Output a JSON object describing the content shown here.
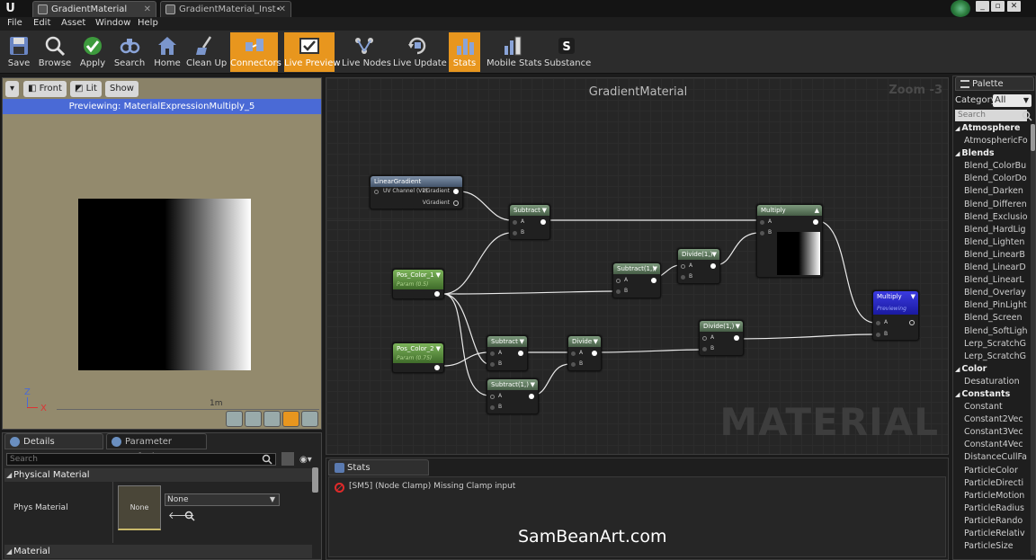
{
  "tabs": [
    {
      "label": "GradientMaterial",
      "active": true
    },
    {
      "label": "GradientMaterial_Inst•",
      "active": false
    }
  ],
  "menu": [
    "File",
    "Edit",
    "Asset",
    "Window",
    "Help"
  ],
  "toolbar": [
    {
      "label": "Save",
      "icon": "save-icon",
      "active": false
    },
    {
      "label": "Browse",
      "icon": "browse-icon",
      "active": false
    },
    {
      "label": "Apply",
      "icon": "apply-icon",
      "active": false
    },
    {
      "label": "Search",
      "icon": "search-icon",
      "active": false
    },
    {
      "label": "Home",
      "icon": "home-icon",
      "active": false
    },
    {
      "label": "Clean Up",
      "icon": "cleanup-icon",
      "active": false
    },
    {
      "label": "Connectors",
      "icon": "connectors-icon",
      "active": true
    },
    {
      "label": "Live Preview",
      "icon": "live-preview-icon",
      "active": true
    },
    {
      "label": "Live Nodes",
      "icon": "live-nodes-icon",
      "active": false
    },
    {
      "label": "Live Update",
      "icon": "live-update-icon",
      "active": false
    },
    {
      "label": "Stats",
      "icon": "stats-icon",
      "active": true
    },
    {
      "label": "Mobile Stats",
      "icon": "mobile-stats-icon",
      "active": false
    },
    {
      "label": "Substance",
      "icon": "substance-icon",
      "active": false
    }
  ],
  "viewport": {
    "front_label": "Front",
    "lit_label": "Lit",
    "show_label": "Show",
    "previewing": "Previewing: MaterialExpressionMultiply_5",
    "axis_z": "Z",
    "axis_x": "X",
    "scale": "1m"
  },
  "details": {
    "tab_details": "Details",
    "tab_params": "Parameter Defaults",
    "search_placeholder": "Search",
    "section_physical": "Physical Material",
    "phys_label": "Phys Material",
    "thumb_label": "None",
    "combo_value": "None",
    "section_material": "Material"
  },
  "graph": {
    "title": "GradientMaterial",
    "zoom": "Zoom -3",
    "watermark": "MATERIAL",
    "nodes": {
      "linear_gradient": {
        "title": "LinearGradient",
        "in": "UV Channel (V2)",
        "out1": "UGradient",
        "out2": "VGradient"
      },
      "pos1": {
        "title": "Pos_Color_1",
        "sub": "Param (0.5)"
      },
      "pos2": {
        "title": "Pos_Color_2",
        "sub": "Param (0.75)"
      },
      "subtract_a": {
        "title": "Subtract"
      },
      "subtract_b": {
        "title": "Subtract(1,)"
      },
      "subtract_c": {
        "title": "Subtract"
      },
      "subtract_d": {
        "title": "Subtract(1,)"
      },
      "divide_a": {
        "title": "Divide(1,)"
      },
      "divide_b": {
        "title": "Divide"
      },
      "divide_c": {
        "title": "Divide(1,)"
      },
      "multiply": {
        "title": "Multiply"
      },
      "result": {
        "title": "Multiply",
        "sub": "Previewing"
      }
    },
    "pin_a": "A",
    "pin_b": "B"
  },
  "stats": {
    "tab_label": "Stats",
    "message": "[SM5] (Node Clamp) Missing Clamp input"
  },
  "watermark_site": "SamBeanArt.com",
  "palette": {
    "tab_label": "Palette",
    "category_label": "Category:",
    "category_value": "All",
    "search_placeholder": "Search",
    "rows": [
      {
        "text": "Atmosphere",
        "type": "cat"
      },
      {
        "text": "AtmosphericFo",
        "type": "item"
      },
      {
        "text": "Blends",
        "type": "cat"
      },
      {
        "text": "Blend_ColorBu",
        "type": "item"
      },
      {
        "text": "Blend_ColorDo",
        "type": "item"
      },
      {
        "text": "Blend_Darken",
        "type": "item"
      },
      {
        "text": "Blend_Differen",
        "type": "item"
      },
      {
        "text": "Blend_Exclusio",
        "type": "item"
      },
      {
        "text": "Blend_HardLig",
        "type": "item"
      },
      {
        "text": "Blend_Lighten",
        "type": "item"
      },
      {
        "text": "Blend_LinearB",
        "type": "item"
      },
      {
        "text": "Blend_LinearD",
        "type": "item"
      },
      {
        "text": "Blend_LinearL",
        "type": "item"
      },
      {
        "text": "Blend_Overlay",
        "type": "item"
      },
      {
        "text": "Blend_PinLight",
        "type": "item"
      },
      {
        "text": "Blend_Screen",
        "type": "item"
      },
      {
        "text": "Blend_SoftLigh",
        "type": "item"
      },
      {
        "text": "Lerp_ScratchG",
        "type": "item"
      },
      {
        "text": "Lerp_ScratchG",
        "type": "item"
      },
      {
        "text": "Color",
        "type": "cat"
      },
      {
        "text": "Desaturation",
        "type": "item"
      },
      {
        "text": "Constants",
        "type": "cat"
      },
      {
        "text": "Constant",
        "type": "item"
      },
      {
        "text": "Constant2Vec",
        "type": "item"
      },
      {
        "text": "Constant3Vec",
        "type": "item"
      },
      {
        "text": "Constant4Vec",
        "type": "item"
      },
      {
        "text": "DistanceCullFa",
        "type": "item"
      },
      {
        "text": "ParticleColor",
        "type": "item"
      },
      {
        "text": "ParticleDirecti",
        "type": "item"
      },
      {
        "text": "ParticleMotion",
        "type": "item"
      },
      {
        "text": "ParticleRadius",
        "type": "item"
      },
      {
        "text": "ParticleRando",
        "type": "item"
      },
      {
        "text": "ParticleRelativ",
        "type": "item"
      },
      {
        "text": "ParticleSize",
        "type": "item"
      }
    ]
  }
}
